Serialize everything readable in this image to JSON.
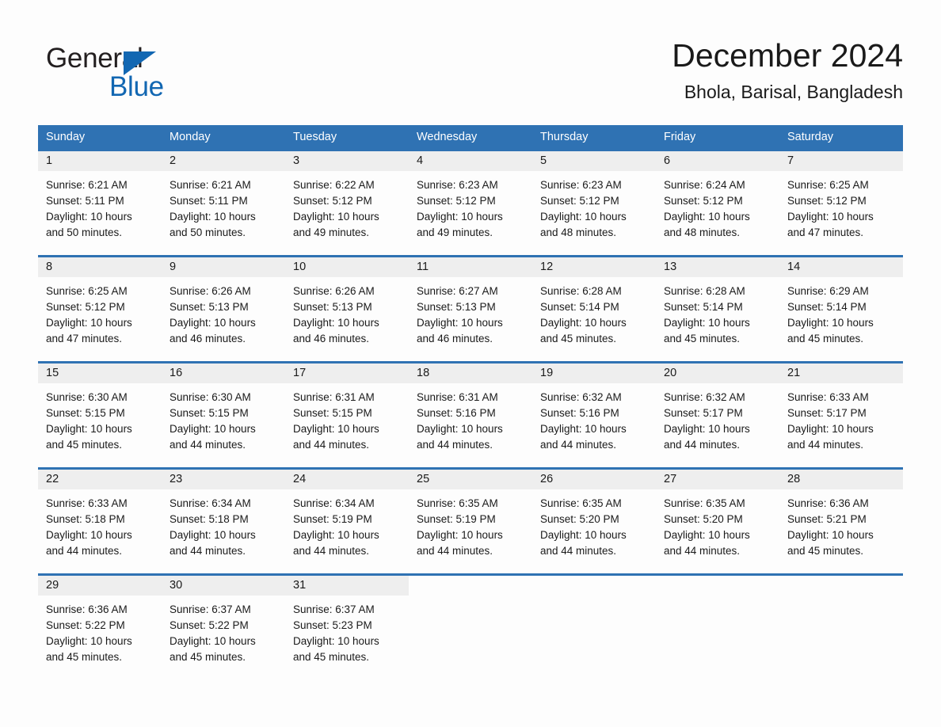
{
  "brand": {
    "name_part1": "General",
    "name_part2": "Blue",
    "accent_color": "#1267b2",
    "triangle_icon": "triangle-icon"
  },
  "header": {
    "title": "December 2024",
    "location": "Bhola, Barisal, Bangladesh"
  },
  "calendar": {
    "header_bg": "#2f72b3",
    "row_rule_color": "#2f72b3",
    "daynum_bg": "#eeeeee",
    "weekdays": [
      "Sunday",
      "Monday",
      "Tuesday",
      "Wednesday",
      "Thursday",
      "Friday",
      "Saturday"
    ],
    "weeks": [
      [
        {
          "day": "1",
          "sunrise": "Sunrise: 6:21 AM",
          "sunset": "Sunset: 5:11 PM",
          "daylight_line1": "Daylight: 10 hours",
          "daylight_line2": "and 50 minutes."
        },
        {
          "day": "2",
          "sunrise": "Sunrise: 6:21 AM",
          "sunset": "Sunset: 5:11 PM",
          "daylight_line1": "Daylight: 10 hours",
          "daylight_line2": "and 50 minutes."
        },
        {
          "day": "3",
          "sunrise": "Sunrise: 6:22 AM",
          "sunset": "Sunset: 5:12 PM",
          "daylight_line1": "Daylight: 10 hours",
          "daylight_line2": "and 49 minutes."
        },
        {
          "day": "4",
          "sunrise": "Sunrise: 6:23 AM",
          "sunset": "Sunset: 5:12 PM",
          "daylight_line1": "Daylight: 10 hours",
          "daylight_line2": "and 49 minutes."
        },
        {
          "day": "5",
          "sunrise": "Sunrise: 6:23 AM",
          "sunset": "Sunset: 5:12 PM",
          "daylight_line1": "Daylight: 10 hours",
          "daylight_line2": "and 48 minutes."
        },
        {
          "day": "6",
          "sunrise": "Sunrise: 6:24 AM",
          "sunset": "Sunset: 5:12 PM",
          "daylight_line1": "Daylight: 10 hours",
          "daylight_line2": "and 48 minutes."
        },
        {
          "day": "7",
          "sunrise": "Sunrise: 6:25 AM",
          "sunset": "Sunset: 5:12 PM",
          "daylight_line1": "Daylight: 10 hours",
          "daylight_line2": "and 47 minutes."
        }
      ],
      [
        {
          "day": "8",
          "sunrise": "Sunrise: 6:25 AM",
          "sunset": "Sunset: 5:12 PM",
          "daylight_line1": "Daylight: 10 hours",
          "daylight_line2": "and 47 minutes."
        },
        {
          "day": "9",
          "sunrise": "Sunrise: 6:26 AM",
          "sunset": "Sunset: 5:13 PM",
          "daylight_line1": "Daylight: 10 hours",
          "daylight_line2": "and 46 minutes."
        },
        {
          "day": "10",
          "sunrise": "Sunrise: 6:26 AM",
          "sunset": "Sunset: 5:13 PM",
          "daylight_line1": "Daylight: 10 hours",
          "daylight_line2": "and 46 minutes."
        },
        {
          "day": "11",
          "sunrise": "Sunrise: 6:27 AM",
          "sunset": "Sunset: 5:13 PM",
          "daylight_line1": "Daylight: 10 hours",
          "daylight_line2": "and 46 minutes."
        },
        {
          "day": "12",
          "sunrise": "Sunrise: 6:28 AM",
          "sunset": "Sunset: 5:14 PM",
          "daylight_line1": "Daylight: 10 hours",
          "daylight_line2": "and 45 minutes."
        },
        {
          "day": "13",
          "sunrise": "Sunrise: 6:28 AM",
          "sunset": "Sunset: 5:14 PM",
          "daylight_line1": "Daylight: 10 hours",
          "daylight_line2": "and 45 minutes."
        },
        {
          "day": "14",
          "sunrise": "Sunrise: 6:29 AM",
          "sunset": "Sunset: 5:14 PM",
          "daylight_line1": "Daylight: 10 hours",
          "daylight_line2": "and 45 minutes."
        }
      ],
      [
        {
          "day": "15",
          "sunrise": "Sunrise: 6:30 AM",
          "sunset": "Sunset: 5:15 PM",
          "daylight_line1": "Daylight: 10 hours",
          "daylight_line2": "and 45 minutes."
        },
        {
          "day": "16",
          "sunrise": "Sunrise: 6:30 AM",
          "sunset": "Sunset: 5:15 PM",
          "daylight_line1": "Daylight: 10 hours",
          "daylight_line2": "and 44 minutes."
        },
        {
          "day": "17",
          "sunrise": "Sunrise: 6:31 AM",
          "sunset": "Sunset: 5:15 PM",
          "daylight_line1": "Daylight: 10 hours",
          "daylight_line2": "and 44 minutes."
        },
        {
          "day": "18",
          "sunrise": "Sunrise: 6:31 AM",
          "sunset": "Sunset: 5:16 PM",
          "daylight_line1": "Daylight: 10 hours",
          "daylight_line2": "and 44 minutes."
        },
        {
          "day": "19",
          "sunrise": "Sunrise: 6:32 AM",
          "sunset": "Sunset: 5:16 PM",
          "daylight_line1": "Daylight: 10 hours",
          "daylight_line2": "and 44 minutes."
        },
        {
          "day": "20",
          "sunrise": "Sunrise: 6:32 AM",
          "sunset": "Sunset: 5:17 PM",
          "daylight_line1": "Daylight: 10 hours",
          "daylight_line2": "and 44 minutes."
        },
        {
          "day": "21",
          "sunrise": "Sunrise: 6:33 AM",
          "sunset": "Sunset: 5:17 PM",
          "daylight_line1": "Daylight: 10 hours",
          "daylight_line2": "and 44 minutes."
        }
      ],
      [
        {
          "day": "22",
          "sunrise": "Sunrise: 6:33 AM",
          "sunset": "Sunset: 5:18 PM",
          "daylight_line1": "Daylight: 10 hours",
          "daylight_line2": "and 44 minutes."
        },
        {
          "day": "23",
          "sunrise": "Sunrise: 6:34 AM",
          "sunset": "Sunset: 5:18 PM",
          "daylight_line1": "Daylight: 10 hours",
          "daylight_line2": "and 44 minutes."
        },
        {
          "day": "24",
          "sunrise": "Sunrise: 6:34 AM",
          "sunset": "Sunset: 5:19 PM",
          "daylight_line1": "Daylight: 10 hours",
          "daylight_line2": "and 44 minutes."
        },
        {
          "day": "25",
          "sunrise": "Sunrise: 6:35 AM",
          "sunset": "Sunset: 5:19 PM",
          "daylight_line1": "Daylight: 10 hours",
          "daylight_line2": "and 44 minutes."
        },
        {
          "day": "26",
          "sunrise": "Sunrise: 6:35 AM",
          "sunset": "Sunset: 5:20 PM",
          "daylight_line1": "Daylight: 10 hours",
          "daylight_line2": "and 44 minutes."
        },
        {
          "day": "27",
          "sunrise": "Sunrise: 6:35 AM",
          "sunset": "Sunset: 5:20 PM",
          "daylight_line1": "Daylight: 10 hours",
          "daylight_line2": "and 44 minutes."
        },
        {
          "day": "28",
          "sunrise": "Sunrise: 6:36 AM",
          "sunset": "Sunset: 5:21 PM",
          "daylight_line1": "Daylight: 10 hours",
          "daylight_line2": "and 45 minutes."
        }
      ],
      [
        {
          "day": "29",
          "sunrise": "Sunrise: 6:36 AM",
          "sunset": "Sunset: 5:22 PM",
          "daylight_line1": "Daylight: 10 hours",
          "daylight_line2": "and 45 minutes."
        },
        {
          "day": "30",
          "sunrise": "Sunrise: 6:37 AM",
          "sunset": "Sunset: 5:22 PM",
          "daylight_line1": "Daylight: 10 hours",
          "daylight_line2": "and 45 minutes."
        },
        {
          "day": "31",
          "sunrise": "Sunrise: 6:37 AM",
          "sunset": "Sunset: 5:23 PM",
          "daylight_line1": "Daylight: 10 hours",
          "daylight_line2": "and 45 minutes."
        },
        {
          "day": "",
          "sunrise": "",
          "sunset": "",
          "daylight_line1": "",
          "daylight_line2": ""
        },
        {
          "day": "",
          "sunrise": "",
          "sunset": "",
          "daylight_line1": "",
          "daylight_line2": ""
        },
        {
          "day": "",
          "sunrise": "",
          "sunset": "",
          "daylight_line1": "",
          "daylight_line2": ""
        },
        {
          "day": "",
          "sunrise": "",
          "sunset": "",
          "daylight_line1": "",
          "daylight_line2": ""
        }
      ]
    ]
  }
}
